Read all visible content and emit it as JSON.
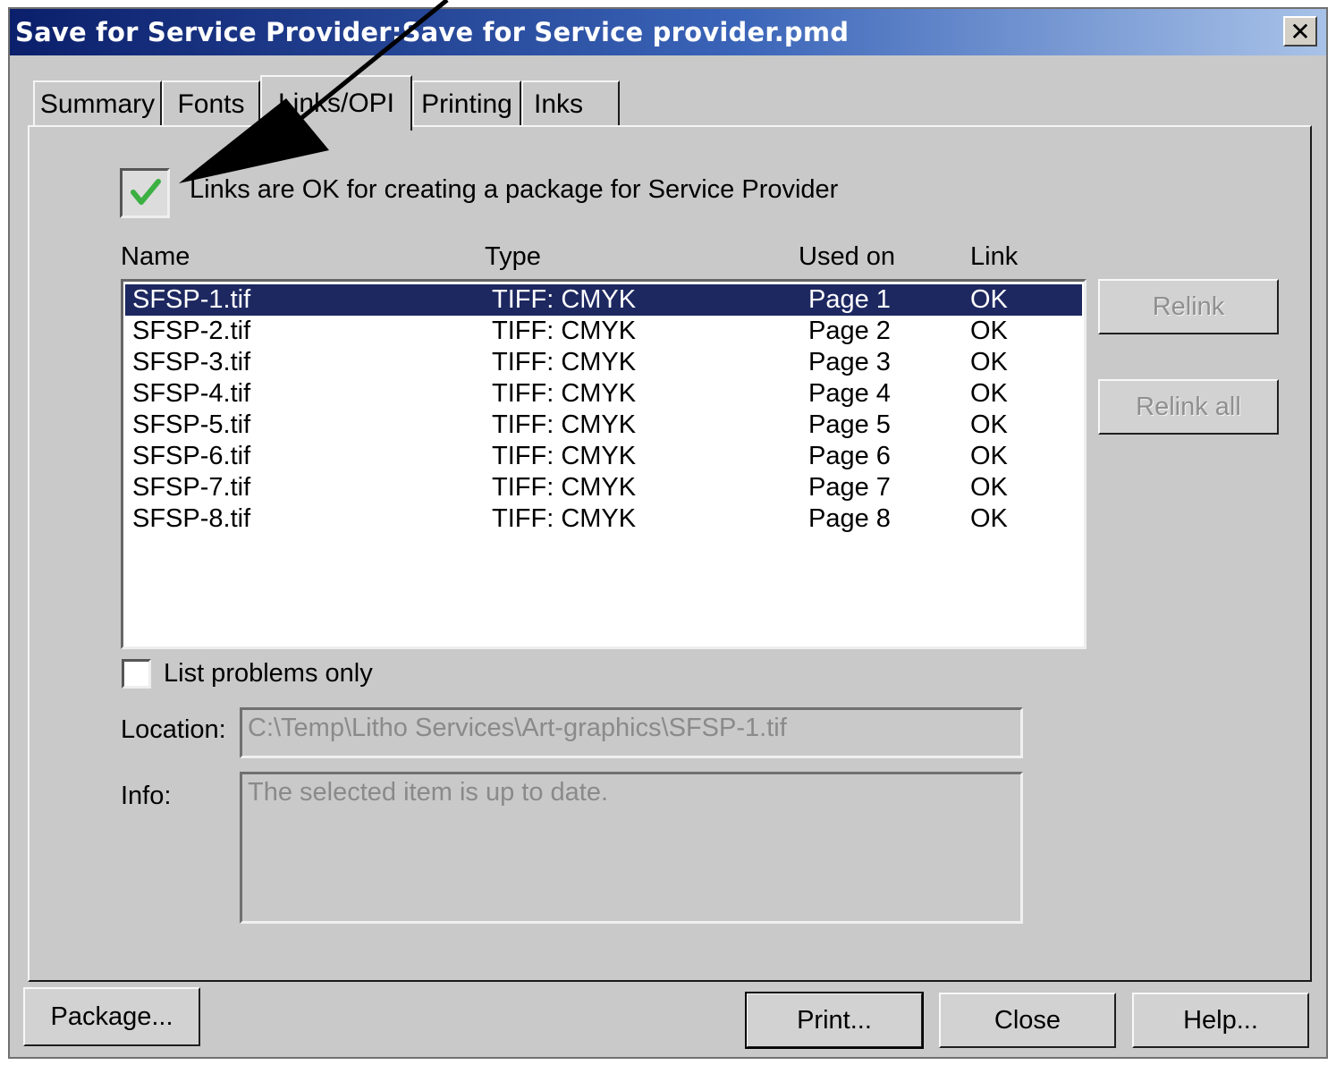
{
  "window": {
    "title": "Save for Service Provider:Save for Service provider.pmd",
    "close_glyph": "✕"
  },
  "tabs": [
    {
      "label": "Summary",
      "active": false
    },
    {
      "label": "Fonts",
      "active": false
    },
    {
      "label": "Links/OPI",
      "active": true
    },
    {
      "label": "Printing",
      "active": false
    },
    {
      "label": "Inks",
      "active": false
    }
  ],
  "status": {
    "checked": true,
    "check_icon": "checkmark-icon",
    "text": "Links are OK for creating a package for Service Provider"
  },
  "table": {
    "headers": {
      "name": "Name",
      "type": "Type",
      "used_on": "Used on",
      "link": "Link"
    },
    "rows": [
      {
        "name": "SFSP-1.tif",
        "type": "TIFF: CMYK",
        "used_on": "Page 1",
        "link": "OK",
        "selected": true
      },
      {
        "name": "SFSP-2.tif",
        "type": "TIFF: CMYK",
        "used_on": "Page 2",
        "link": "OK"
      },
      {
        "name": "SFSP-3.tif",
        "type": "TIFF: CMYK",
        "used_on": "Page 3",
        "link": "OK"
      },
      {
        "name": "SFSP-4.tif",
        "type": "TIFF: CMYK",
        "used_on": "Page 4",
        "link": "OK"
      },
      {
        "name": "SFSP-5.tif",
        "type": "TIFF: CMYK",
        "used_on": "Page 5",
        "link": "OK"
      },
      {
        "name": "SFSP-6.tif",
        "type": "TIFF: CMYK",
        "used_on": "Page 6",
        "link": "OK"
      },
      {
        "name": "SFSP-7.tif",
        "type": "TIFF: CMYK",
        "used_on": "Page 7",
        "link": "OK"
      },
      {
        "name": "SFSP-8.tif",
        "type": "TIFF: CMYK",
        "used_on": "Page 8",
        "link": "OK"
      }
    ]
  },
  "side_buttons": {
    "relink": "Relink",
    "relink_all": "Relink all"
  },
  "list_problems": {
    "label": "List problems only",
    "checked": false
  },
  "location": {
    "label": "Location:",
    "value": "C:\\Temp\\Litho Services\\Art-graphics\\SFSP-1.tif"
  },
  "info": {
    "label": "Info:",
    "value": "The selected item is up to date."
  },
  "footer": {
    "package": "Package...",
    "print": "Print...",
    "close": "Close",
    "help": "Help..."
  },
  "colors": {
    "dialog_bg": "#c9c9c9",
    "title_dark": "#0b1f6b",
    "selection": "#1d2860",
    "check_green": "#3cb043"
  }
}
